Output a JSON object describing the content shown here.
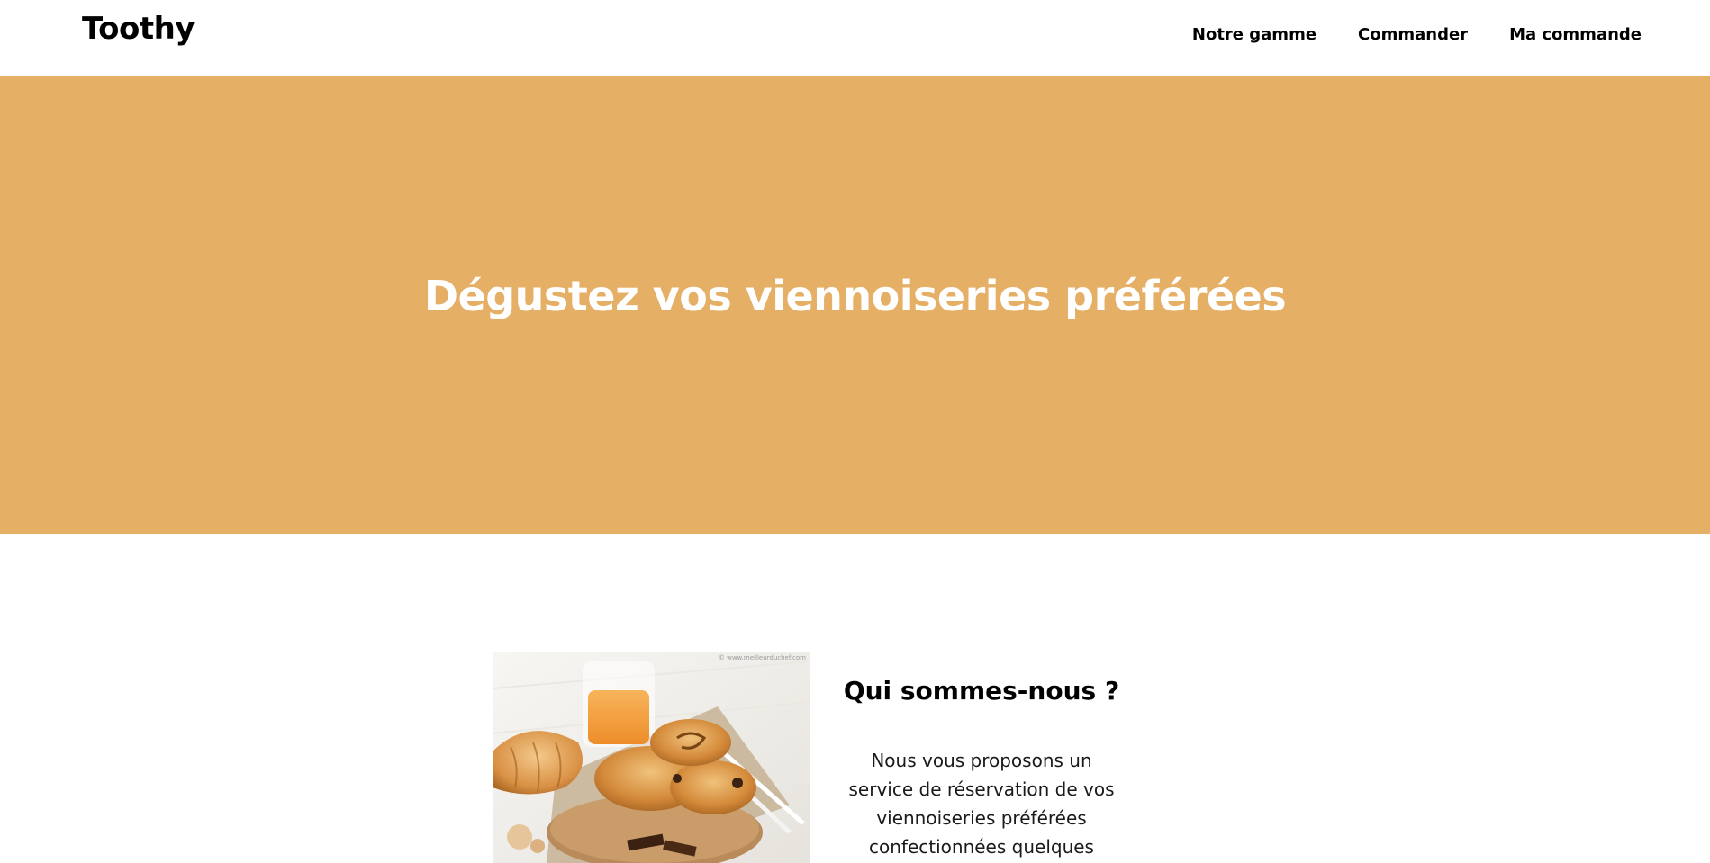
{
  "header": {
    "brand": "Toothy",
    "nav": [
      {
        "label": "Notre gamme"
      },
      {
        "label": "Commander"
      },
      {
        "label": "Ma commande"
      }
    ]
  },
  "hero": {
    "title": "Dégustez vos viennoiseries préférées",
    "background_color": "#e5af66"
  },
  "about": {
    "image_watermark": "© www.meilleurduchef.com",
    "title": "Qui sommes-nous ?",
    "body": "Nous vous proposons un service de réservation de vos viennoiseries préférées confectionnées quelques heures"
  }
}
